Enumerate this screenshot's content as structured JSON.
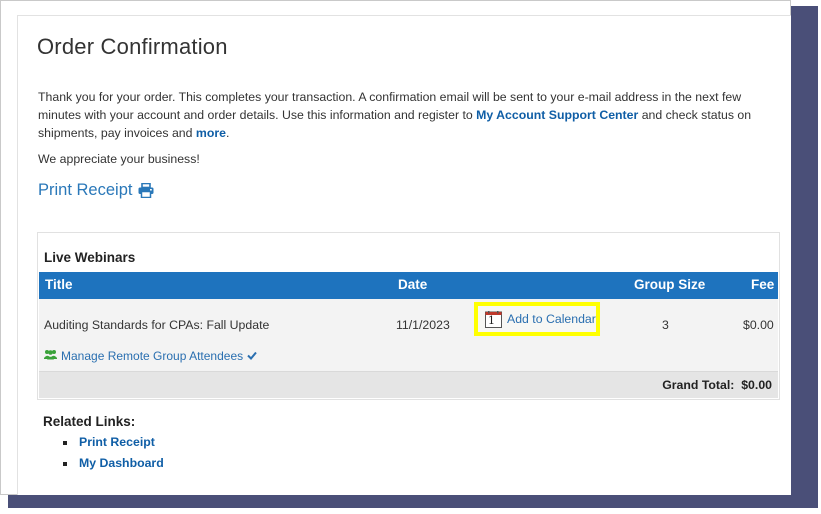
{
  "page": {
    "title": "Order Confirmation",
    "intro": {
      "text_before": "Thank you for your order. This completes your transaction. A confirmation email will be sent to your e-mail address in the next few minutes with your account and order details. Use this information and register to ",
      "link_support": "My Account Support Center",
      "text_middle": " and check status on shipments, pay invoices and ",
      "link_more": "more",
      "text_after": "."
    },
    "appreciation": "We appreciate your business!",
    "print_receipt_label": "Print Receipt"
  },
  "orders": {
    "section_title": "Live Webinars",
    "columns": {
      "title": "Title",
      "date": "Date",
      "group_size": "Group Size",
      "fee": "Fee"
    },
    "rows": [
      {
        "title": "Auditing Standards for CPAs: Fall Update",
        "date": "11/1/2023",
        "calendar_day": "1",
        "add_to_calendar": "Add to Calendar",
        "group_size": "3",
        "fee": "$0.00",
        "manage_label": "Manage Remote Group Attendees"
      }
    ],
    "grand_total_label": "Grand Total:",
    "grand_total_value": "$0.00"
  },
  "related": {
    "title": "Related Links:",
    "links": [
      "Print Receipt",
      "My Dashboard"
    ]
  },
  "colors": {
    "header_blue": "#1e73be",
    "link_blue": "#0f5ea6",
    "highlight": "#ffff00",
    "shadow": "#4a4f78",
    "group_icon_green": "#3aa23a"
  },
  "icons": {
    "print": "printer-icon",
    "calendar": "calendar-icon",
    "group": "users-group-icon",
    "check": "checkmark-icon"
  }
}
